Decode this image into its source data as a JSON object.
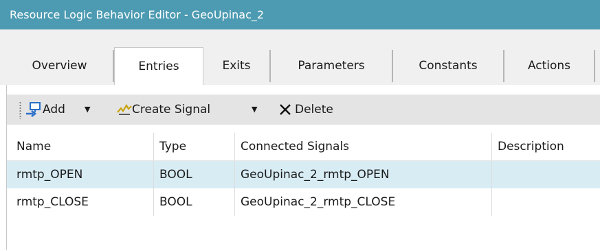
{
  "window": {
    "title": "Resource Logic Behavior Editor - GeoUpinac_2"
  },
  "tabs": [
    {
      "label": "Overview"
    },
    {
      "label": "Entries",
      "selected": true
    },
    {
      "label": "Exits"
    },
    {
      "label": "Parameters"
    },
    {
      "label": "Constants"
    },
    {
      "label": "Actions"
    }
  ],
  "toolbar": {
    "add_label": "Add",
    "create_signal_label": "Create Signal",
    "delete_label": "Delete"
  },
  "grid": {
    "columns": [
      "Name",
      "Type",
      "Connected Signals",
      "Description"
    ],
    "rows": [
      {
        "name": "rmtp_OPEN",
        "type": "BOOL",
        "signals": "GeoUpinac_2_rmtp_OPEN",
        "description": "",
        "selected": true
      },
      {
        "name": "rmtp_CLOSE",
        "type": "BOOL",
        "signals": "GeoUpinac_2_rmtp_CLOSE",
        "description": ""
      }
    ]
  },
  "colors": {
    "titlebar": "#4d9bb2",
    "selected_row": "#d8ecf4",
    "toolbar": "#e4e4e4"
  }
}
